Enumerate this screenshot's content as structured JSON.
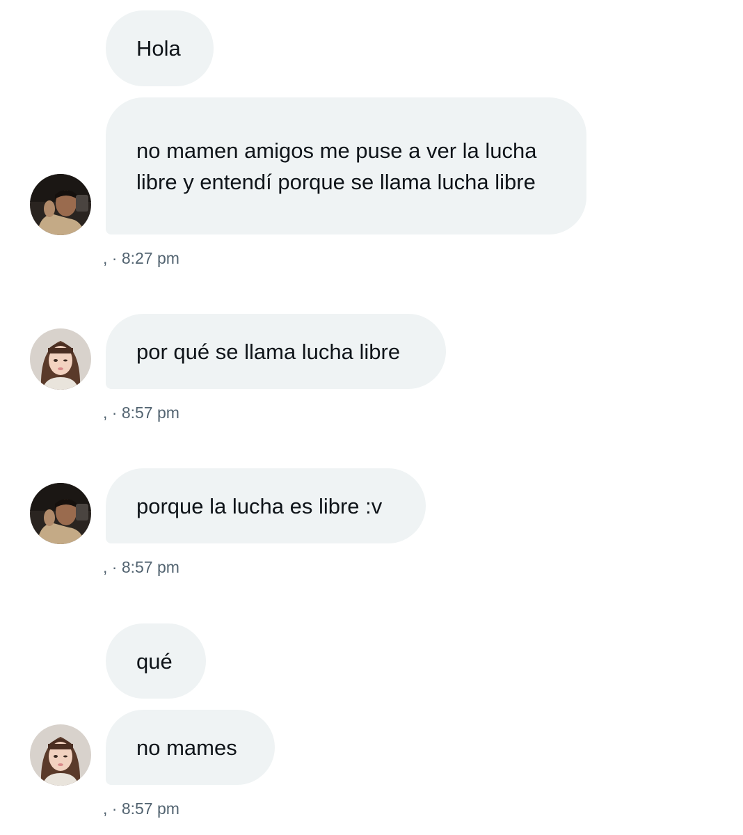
{
  "conversation": {
    "messages": [
      {
        "text": "Hola"
      },
      {
        "text": "no mamen amigos me puse a ver la lucha libre y entendí porque se llama lucha libre"
      },
      {
        "text": "por qué se llama lucha libre"
      },
      {
        "text": "porque la lucha es libre :v"
      },
      {
        "text": "qué"
      },
      {
        "text": "no mames"
      }
    ],
    "timestamps": [
      {
        "text": ", · 8:27 pm"
      },
      {
        "text": ", · 8:57 pm"
      },
      {
        "text": ", · 8:57 pm"
      },
      {
        "text": ", · 8:57 pm"
      }
    ],
    "colors": {
      "bubble_bg": "#eff3f4",
      "text": "#0f1419",
      "meta": "#536471"
    }
  }
}
